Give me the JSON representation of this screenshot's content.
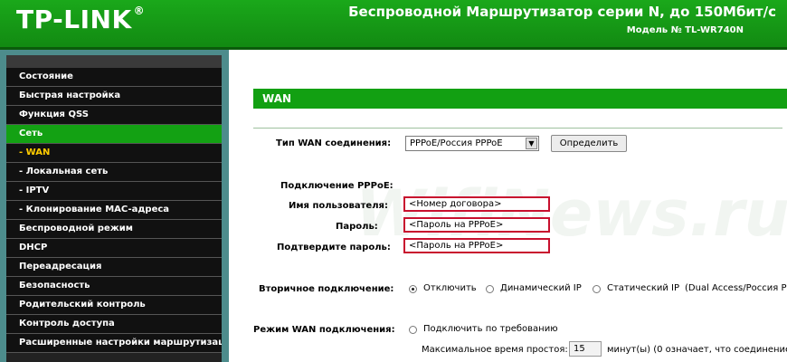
{
  "header": {
    "logo": "TP-LINK",
    "logo_mark": "®",
    "title": "Беспроводной Маршрутизатор серии N, до 150Мбит/с",
    "model": "Модель № TL-WR740N"
  },
  "sidebar": {
    "items": [
      {
        "label": "Состояние"
      },
      {
        "label": "Быстрая настройка"
      },
      {
        "label": "Функция QSS"
      },
      {
        "label": "Сеть"
      },
      {
        "label": "- WAN"
      },
      {
        "label": "- Локальная сеть"
      },
      {
        "label": "- IPTV"
      },
      {
        "label": "- Клонирование MAC-адреса"
      },
      {
        "label": "Беспроводной режим"
      },
      {
        "label": "DHCP"
      },
      {
        "label": "Переадресация"
      },
      {
        "label": "Безопасность"
      },
      {
        "label": "Родительский контроль"
      },
      {
        "label": "Контроль доступа"
      },
      {
        "label": "Расширенные настройки маршрутизации"
      }
    ]
  },
  "main": {
    "section_title": "WAN",
    "wan_type_label": "Тип WAN соединения:",
    "wan_type_value": "PPPoE/Россия PPPoE",
    "detect_button": "Определить",
    "pppoe_heading": "Подключение PPPoE:",
    "username_label": "Имя пользователя:",
    "username_value": "<Номер договора>",
    "password_label": "Пароль:",
    "password_value": "<Пароль на PPPoE>",
    "confirm_label": "Подтвердите пароль:",
    "confirm_value": "<Пароль на PPPoE>",
    "secondary_label": "Вторичное подключение:",
    "secondary_options": [
      "Отключить",
      "Динамический IP",
      "Статический IP",
      "(Dual Access/Россия P"
    ],
    "mode_label": "Режим WAN подключения:",
    "mode_option_on_demand": "Подключить по требованию",
    "idle_label": "Максимальное время простоя:",
    "idle_value": "15",
    "idle_suffix": "минут(ы) (0 означает, что соединение б"
  },
  "watermark": "WifiNews.ru"
}
